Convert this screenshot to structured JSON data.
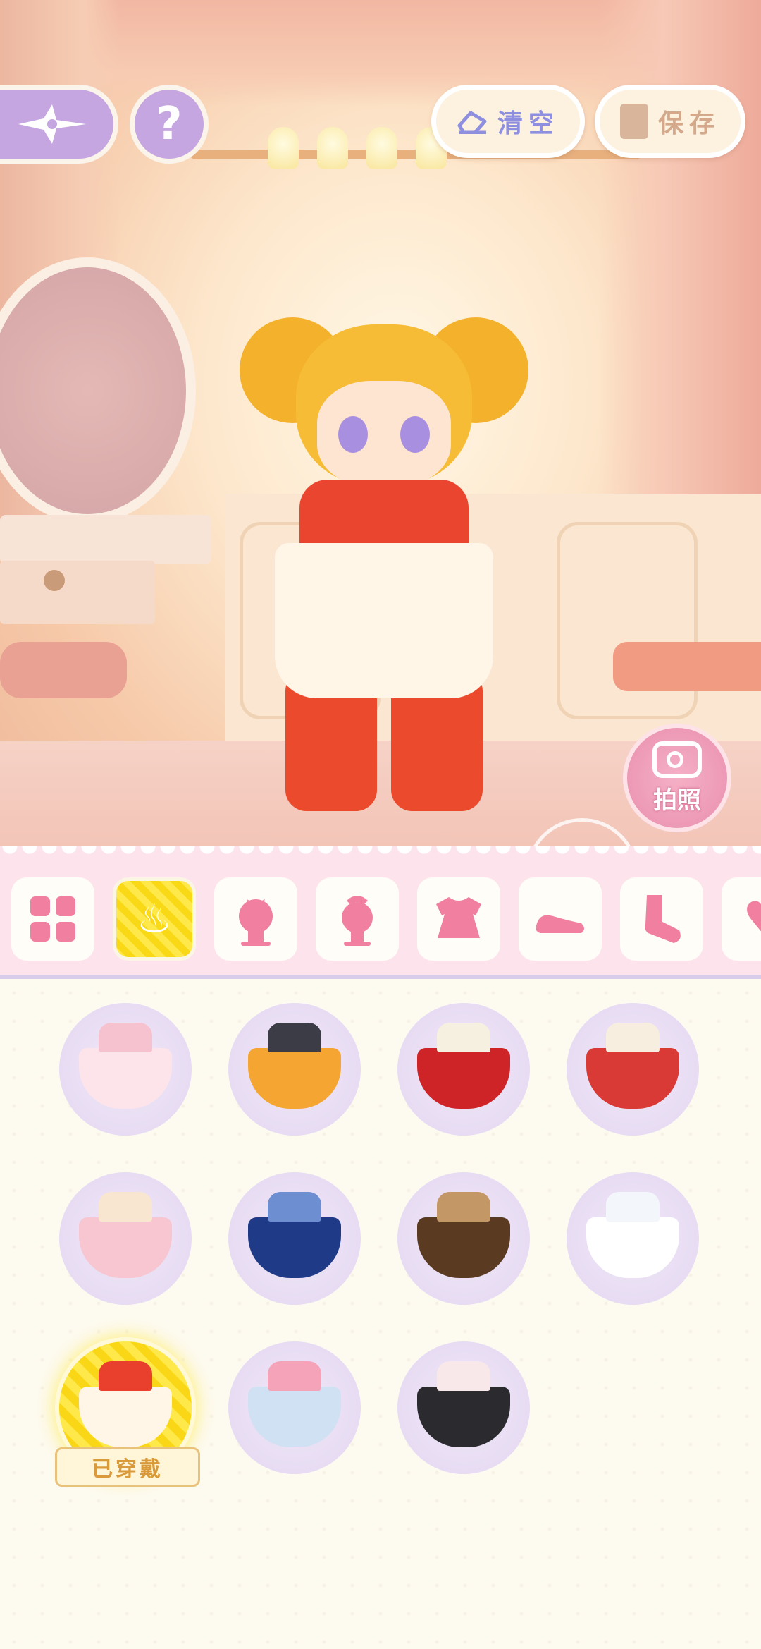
{
  "header": {
    "back_icon": "compass-star-icon",
    "help_label": "?",
    "clear_label": "清空",
    "save_label": "保存"
  },
  "scene": {
    "photo_label": "拍照"
  },
  "tabs": [
    {
      "icon": "all-grid-icon",
      "active": false
    },
    {
      "icon": "outfit-hanger-icon",
      "active": true
    },
    {
      "icon": "hair-bow-icon",
      "active": false
    },
    {
      "icon": "headwear-icon",
      "active": false
    },
    {
      "icon": "dress-icon",
      "active": false
    },
    {
      "icon": "shoe-icon",
      "active": false
    },
    {
      "icon": "sock-icon",
      "active": false
    },
    {
      "icon": "accessory-icon",
      "active": false
    }
  ],
  "items": [
    {
      "name": "pink-sailor-dress",
      "top": "#f7c2cf",
      "skirt": "#fde4ea"
    },
    {
      "name": "orange-cat-outfit",
      "top": "#3c3c46",
      "skirt": "#f5a531"
    },
    {
      "name": "red-christmas-dress",
      "top": "#f6f0e0",
      "skirt": "#cf2427"
    },
    {
      "name": "red-white-festival-dress",
      "top": "#f8eee0",
      "skirt": "#d93a35"
    },
    {
      "name": "pink-apron-dress",
      "top": "#f9e6d0",
      "skirt": "#f7c6d0"
    },
    {
      "name": "navy-star-dress",
      "top": "#6d8ed0",
      "skirt": "#1f3a86"
    },
    {
      "name": "brown-trench-coat",
      "top": "#c49866",
      "skirt": "#5b3a22"
    },
    {
      "name": "white-slip-dress",
      "top": "#f3f6fb",
      "skirt": "#ffffff"
    },
    {
      "name": "red-qipao-apron-outfit",
      "top": "#e8402c",
      "skirt": "#fff6e8",
      "worn": true,
      "worn_label": "已穿戴"
    },
    {
      "name": "pink-sweater-outfit",
      "top": "#f5a3b8",
      "skirt": "#cfe1f2"
    },
    {
      "name": "black-maid-dress",
      "top": "#f8e8ea",
      "skirt": "#2b2b2f"
    }
  ],
  "colors": {
    "accent_purple": "#c5a6e0",
    "tab_pink": "#f07fa0",
    "active_yellow": "#ffe94a"
  }
}
